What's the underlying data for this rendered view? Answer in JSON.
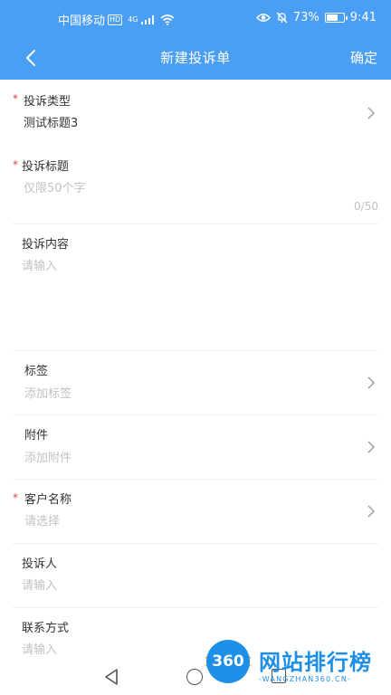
{
  "status_bar": {
    "carrier": "中国移动",
    "hd": "HD",
    "network": "4G",
    "battery": "73%",
    "battery_level": 0.73,
    "time": "9:41"
  },
  "navbar": {
    "title": "新建投诉单",
    "confirm": "确定"
  },
  "form": {
    "type": {
      "label": "投诉类型",
      "value": "测试标题3",
      "required": "*"
    },
    "title": {
      "label": "投诉标题",
      "placeholder": "仅限50个字",
      "counter": "0/50",
      "required": "*"
    },
    "content": {
      "label": "投诉内容",
      "placeholder": "请输入"
    },
    "tags": {
      "label": "标签",
      "placeholder": "添加标签"
    },
    "attachment": {
      "label": "附件",
      "placeholder": "添加附件"
    },
    "customer": {
      "label": "客户名称",
      "placeholder": "请选择",
      "required": "*"
    },
    "complainant": {
      "label": "投诉人",
      "placeholder": "请输入"
    },
    "contact": {
      "label": "联系方式",
      "placeholder": "请输入"
    }
  },
  "watermark": {
    "logo": "360",
    "title": "网站排行榜",
    "subtitle": "-WANGZHAN360.CN-"
  },
  "colors": {
    "header": "#4a9ff5",
    "required": "#e03c3c",
    "placeholder": "#c2c2c2"
  }
}
